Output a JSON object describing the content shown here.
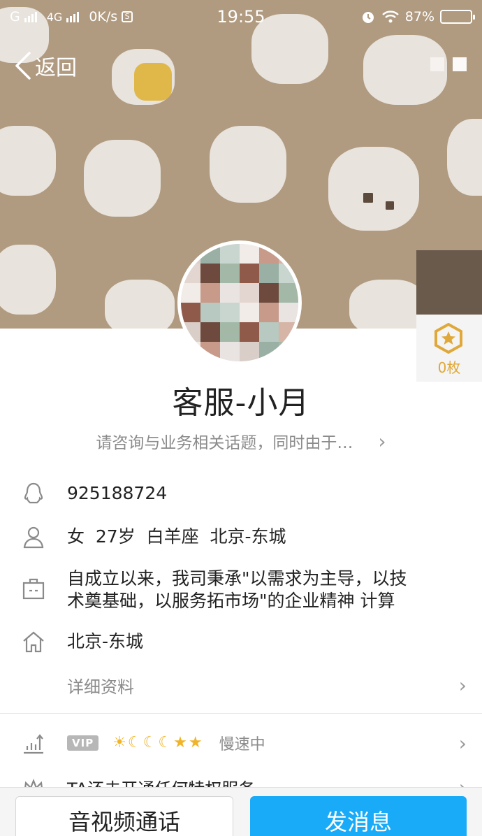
{
  "status_bar": {
    "sim1": "G",
    "sim2": "4G",
    "speed": "0K/s",
    "time": "19:55",
    "battery": "87%",
    "battery_level": 0.87
  },
  "nav": {
    "back_label": "返回"
  },
  "profile": {
    "name": "客服-小月",
    "signature": "请咨询与业务相关话题，同时由于…",
    "medal_count": "0枚",
    "qq_number": "925188724",
    "basic_info": "女  27岁  白羊座  北京-东城",
    "company_line1": "自成立以来，我司秉承\"以需求为主导，以技",
    "company_line2": "术奠基础，以服务拓市场\"的企业精神 计算",
    "location": "北京-东城",
    "detail_label": "详细资料"
  },
  "vip": {
    "badge": "VIP",
    "level_icons": [
      "sun-icon",
      "moon-icon",
      "moon-icon",
      "moon-icon",
      "star-icon",
      "star-icon"
    ],
    "status": "慢速中"
  },
  "privilege": {
    "text": "TA还未开通任何特权服务"
  },
  "actions": {
    "call_label": "音视频通话",
    "message_label": "发消息"
  },
  "colors": {
    "accent": "#19aaf8",
    "medal": "#e0a838",
    "vip_level": "#f0b429"
  }
}
